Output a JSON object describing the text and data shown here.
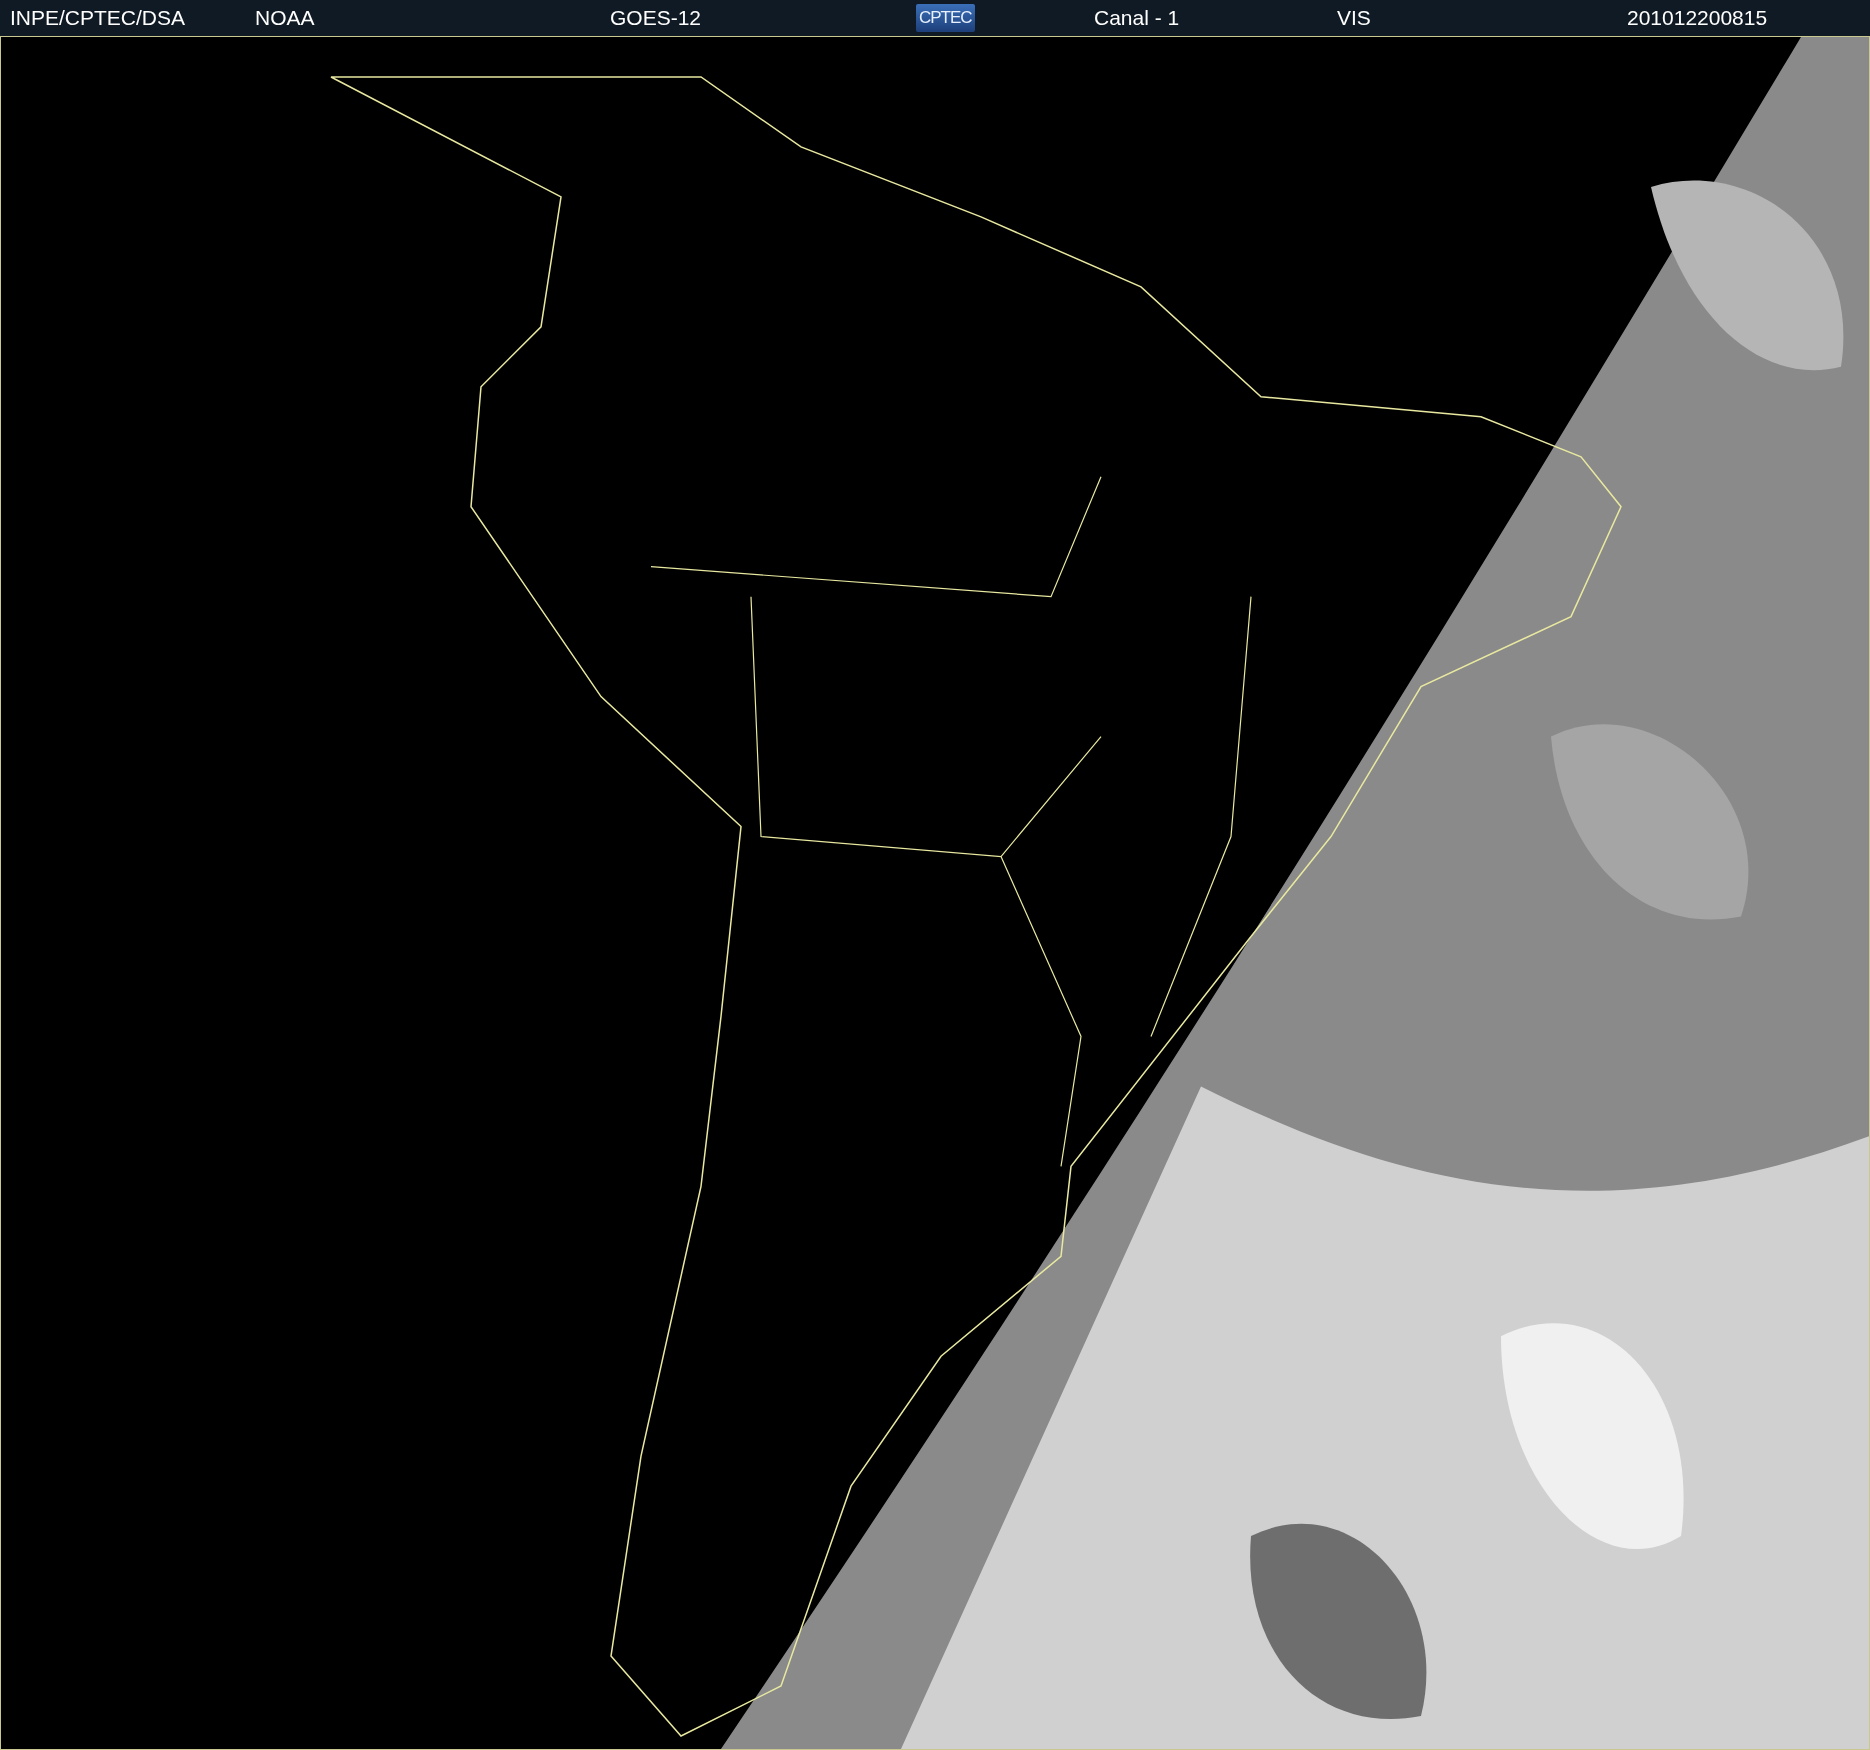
{
  "header": {
    "items": [
      {
        "kind": "text",
        "text": "INPE/CPTEC/DSA"
      },
      {
        "kind": "text",
        "text": "NOAA"
      },
      {
        "kind": "text",
        "text": "GOES-12"
      },
      {
        "kind": "logo",
        "text": "CPTEC"
      },
      {
        "kind": "text",
        "text": "Canal - 1"
      },
      {
        "kind": "text",
        "text": "VIS"
      },
      {
        "kind": "text",
        "text": "201012200815"
      }
    ]
  }
}
